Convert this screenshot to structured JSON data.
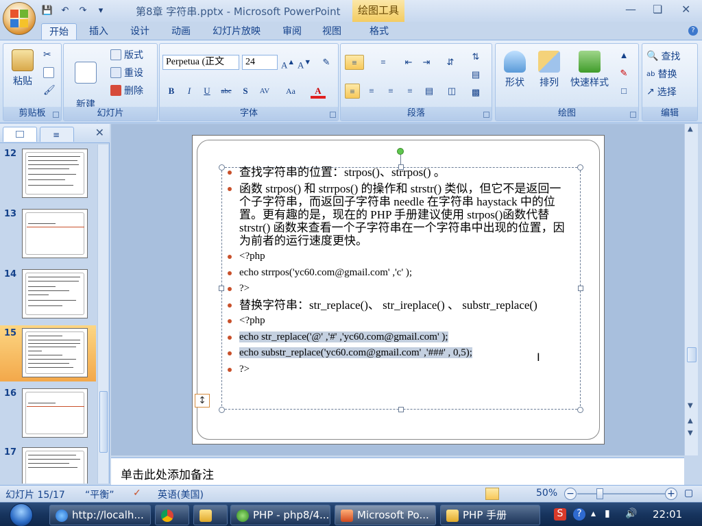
{
  "window": {
    "title": "第8章 字符串.pptx - Microsoft PowerPoint",
    "context_tab": "绘图工具"
  },
  "tabs": [
    "开始",
    "插入",
    "设计",
    "动画",
    "幻灯片放映",
    "审阅",
    "视图",
    "格式"
  ],
  "ribbon": {
    "clipboard": {
      "label": "剪贴板",
      "paste": "粘贴"
    },
    "slides": {
      "label": "幻灯片",
      "new_slide": "新建\n幻灯片",
      "layout": "版式",
      "reset": "重设",
      "delete": "删除"
    },
    "font": {
      "label": "字体",
      "family": "Perpetua (正文",
      "size": "24"
    },
    "paragraph": {
      "label": "段落"
    },
    "drawing": {
      "label": "绘图",
      "shapes": "形状",
      "arrange": "排列",
      "quick_styles": "快速样式"
    },
    "editing": {
      "label": "编辑",
      "find": "查找",
      "replace": "替换",
      "select": "选择"
    }
  },
  "slides_panel": {
    "items": [
      {
        "num": "12",
        "title_only": false
      },
      {
        "num": "13",
        "title_only": true
      },
      {
        "num": "14",
        "title_only": false
      },
      {
        "num": "15",
        "title_only": false,
        "selected": true
      },
      {
        "num": "16",
        "title_only": true
      },
      {
        "num": "17",
        "title_only": false
      }
    ]
  },
  "slide": {
    "bullets": [
      "查找字符串的位置：strpos()、strrpos() 。",
      "函数 strpos() 和 strrpos() 的操作和 strstr() 类似，但它不是返回一个子字符串，而返回子字符串 needle 在字符串 haystack 中的位置。更有趣的是，现在的 PHP 手册建议使用 strpos()函数代替 strstr() 函数来查看一个子字符串在一个字符串中出现的位置，因为前者的运行速度更快。",
      "<?php",
      "echo strrpos('yc60.com@gmail.com' ,'c' );",
      "?>",
      "替换字符串：str_replace()、 str_ireplace() 、 substr_replace()",
      "<?php",
      "echo str_replace('@' ,'#' ,'yc60.com@gmail.com' );",
      "echo substr_replace('yc60.com@gmail.com' ,'###' , 0,5);",
      "?>"
    ]
  },
  "notes": {
    "placeholder": "单击此处添加备注"
  },
  "status": {
    "slide_info": "幻灯片 15/17",
    "theme": "“平衡”",
    "language": "英语(美国)",
    "zoom": "50%",
    "zoom_value": 50
  },
  "taskbar": {
    "items": [
      {
        "label": "http://localh...",
        "icon": "ie-icon"
      },
      {
        "label": "",
        "icon": "chrome-icon"
      },
      {
        "label": "",
        "icon": "folder-icon"
      },
      {
        "label": "PHP - php8/4...",
        "icon": "php-editor-icon"
      },
      {
        "label": "Microsoft Po...",
        "icon": "powerpoint-icon",
        "active": true
      },
      {
        "label": "PHP 手册",
        "icon": "help-icon"
      }
    ],
    "time": "22:01"
  }
}
